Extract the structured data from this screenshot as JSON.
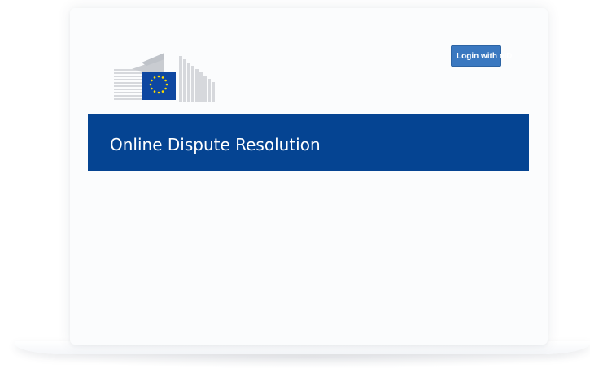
{
  "header": {
    "login_label": "Login with eID"
  },
  "banner": {
    "title": "Online Dispute Resolution"
  },
  "colors": {
    "banner_blue": "#054492",
    "button_blue": "#3a78c0",
    "eu_flag_blue": "#0e47a1",
    "eu_star_yellow": "#ffdd00"
  },
  "icons": {
    "logo": "european-commission-logo-icon"
  }
}
